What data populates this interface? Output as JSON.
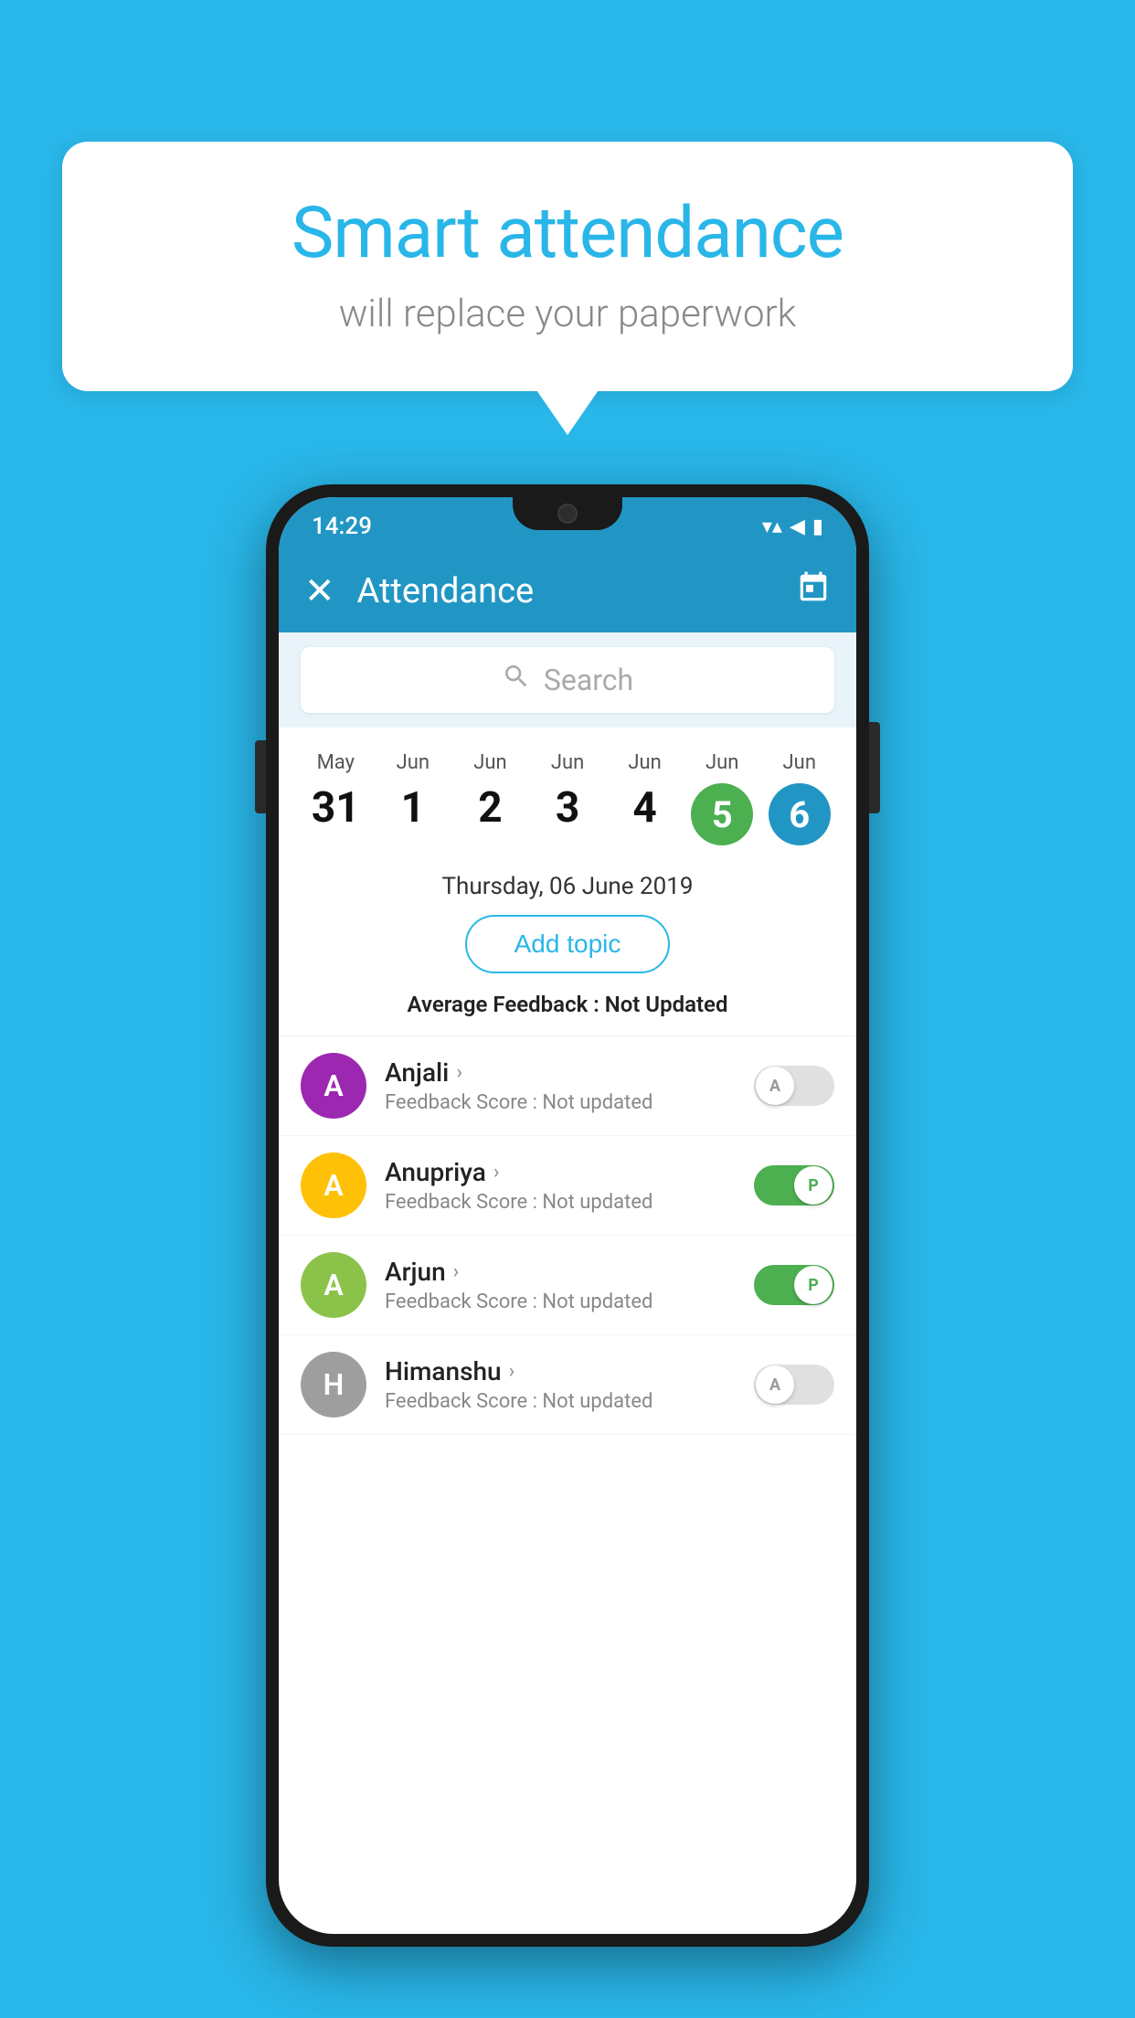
{
  "background_color": "#29b6e8",
  "bubble": {
    "title": "Smart attendance",
    "subtitle": "will replace your paperwork"
  },
  "status_bar": {
    "time": "14:29",
    "wifi": "▼",
    "signal": "▲",
    "battery": "▮"
  },
  "header": {
    "title": "Attendance",
    "close_label": "✕",
    "calendar_icon": "📅"
  },
  "search": {
    "placeholder": "Search"
  },
  "dates": [
    {
      "month": "May",
      "day": "31",
      "state": "normal"
    },
    {
      "month": "Jun",
      "day": "1",
      "state": "normal"
    },
    {
      "month": "Jun",
      "day": "2",
      "state": "normal"
    },
    {
      "month": "Jun",
      "day": "3",
      "state": "normal"
    },
    {
      "month": "Jun",
      "day": "4",
      "state": "normal"
    },
    {
      "month": "Jun",
      "day": "5",
      "state": "today"
    },
    {
      "month": "Jun",
      "day": "6",
      "state": "selected"
    }
  ],
  "selected_date_label": "Thursday, 06 June 2019",
  "add_topic_label": "Add topic",
  "avg_feedback_label": "Average Feedback :",
  "avg_feedback_value": "Not Updated",
  "students": [
    {
      "name": "Anjali",
      "avatar_letter": "A",
      "avatar_color": "#9C27B0",
      "feedback_label": "Feedback Score :",
      "feedback_value": "Not updated",
      "toggle_state": "off",
      "toggle_letter": "A"
    },
    {
      "name": "Anupriya",
      "avatar_letter": "A",
      "avatar_color": "#FFC107",
      "feedback_label": "Feedback Score :",
      "feedback_value": "Not updated",
      "toggle_state": "on",
      "toggle_letter": "P"
    },
    {
      "name": "Arjun",
      "avatar_letter": "A",
      "avatar_color": "#8BC34A",
      "feedback_label": "Feedback Score :",
      "feedback_value": "Not updated",
      "toggle_state": "on",
      "toggle_letter": "P"
    },
    {
      "name": "Himanshu",
      "avatar_letter": "H",
      "avatar_color": "#9E9E9E",
      "feedback_label": "Feedback Score :",
      "feedback_value": "Not updated",
      "toggle_state": "off",
      "toggle_letter": "A"
    }
  ]
}
